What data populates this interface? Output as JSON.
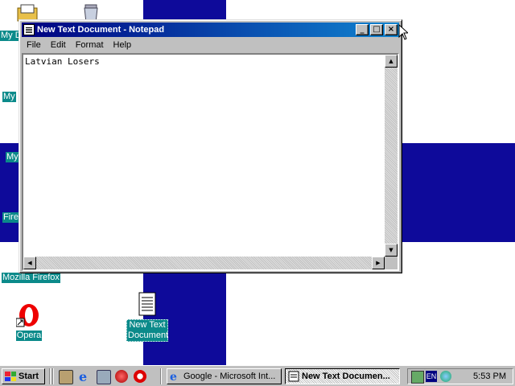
{
  "desktop": {
    "icons": [
      {
        "label": "My Documents (partial)",
        "display": "My D"
      },
      {
        "label": "Recycle Bin",
        "display": ""
      },
      {
        "label": "My Computer (partial)",
        "display": "My"
      },
      {
        "label": "My Network (partial)",
        "display": "My"
      },
      {
        "label": "Firefox (partial)",
        "display": "Fire"
      },
      {
        "label": "Mozilla Firefox",
        "display": "Mozilla Firefox"
      },
      {
        "label": "Opera",
        "display": "Opera"
      },
      {
        "label": "New Text Document",
        "display": "New Text Document"
      }
    ]
  },
  "window": {
    "title": "New Text Document - Notepad",
    "buttons": {
      "minimize": "_",
      "maximize": "□",
      "close": "×"
    },
    "menu": [
      "File",
      "Edit",
      "Format",
      "Help"
    ],
    "content": "Latvian Losers"
  },
  "taskbar": {
    "start_label": "Start",
    "tasks": [
      {
        "label": "Google - Microsoft Int..."
      },
      {
        "label": "New Text Documen..."
      }
    ],
    "tray_lang": "EN",
    "clock": "5:53 PM"
  },
  "colors": {
    "wallpaper_blue": "#0e0a9a",
    "title_gradient_start": "#000080",
    "title_gradient_end": "#1084d0",
    "icon_label_bg": "#0b8a8a"
  }
}
